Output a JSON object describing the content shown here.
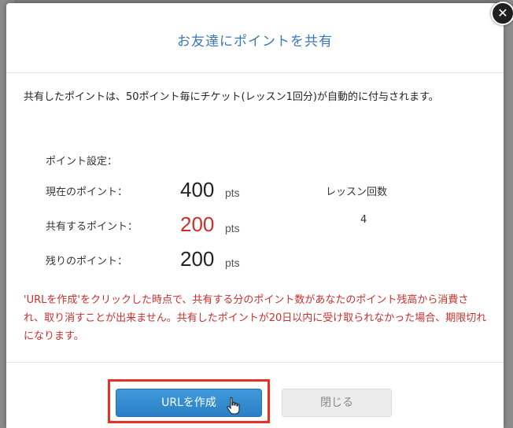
{
  "modal": {
    "title": "お友達にポイントを共有",
    "close_icon": "close-icon",
    "intro": "共有したポイントは、50ポイント毎にチケット(レッスン1回分)が自動的に付与されます。",
    "points_settings_label": "ポイント設定：",
    "rows": [
      {
        "label": "現在のポイント：",
        "value": "400",
        "unit": "pts"
      },
      {
        "label": "共有するポイント：",
        "value": "200",
        "unit": "pts"
      },
      {
        "label": "残りのポイント：",
        "value": "200",
        "unit": "pts"
      }
    ],
    "lesson_label": "レッスン回数",
    "lesson_value": "4",
    "warning": "'URLを作成'をクリックした時点で、共有する分のポイント数があなたのポイント残高から消費され、取り消すことが出来ません。共有したポイントが20日以内に受け取られなかった場合、期限切れになります。",
    "create_url_button": "URLを作成",
    "close_button": "閉じる"
  },
  "colors": {
    "title": "#3a77b5",
    "warning": "#c9302c",
    "primary_button": "#2b7fc4",
    "highlight": "#e8321f"
  }
}
